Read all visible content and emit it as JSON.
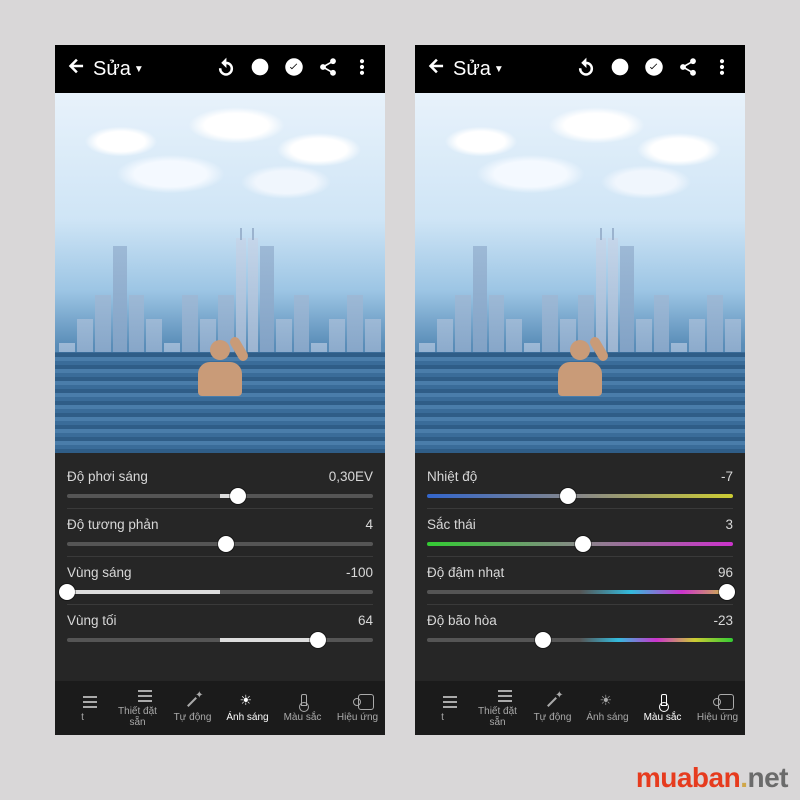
{
  "watermark": {
    "brand": "muaban",
    "dot": ".",
    "tld": "net"
  },
  "phones": [
    {
      "title": "Sửa",
      "sliders": [
        {
          "label": "Độ phơi sáng",
          "value": "0,30EV",
          "pct": 56
        },
        {
          "label": "Độ tương phản",
          "value": "4",
          "pct": 52
        },
        {
          "label": "Vùng sáng",
          "value": "-100",
          "pct": 0,
          "half": true
        },
        {
          "label": "Vùng tối",
          "value": "64",
          "pct": 82
        }
      ],
      "tabs": [
        {
          "label": "t",
          "icon": "sliders"
        },
        {
          "label": "Thiết đặt sẵn",
          "icon": "sliders"
        },
        {
          "label": "Tự động",
          "icon": "wand"
        },
        {
          "label": "Ánh sáng",
          "icon": "sun",
          "active": true
        },
        {
          "label": "Màu sắc",
          "icon": "therm"
        },
        {
          "label": "Hiệu ứng",
          "icon": "fx"
        }
      ]
    },
    {
      "title": "Sửa",
      "sliders": [
        {
          "label": "Nhiệt độ",
          "value": "-7",
          "pct": 46,
          "track": "temp"
        },
        {
          "label": "Sắc thái",
          "value": "3",
          "pct": 51,
          "track": "tint"
        },
        {
          "label": "Độ đậm nhạt",
          "value": "96",
          "pct": 98,
          "track": "vib"
        },
        {
          "label": "Độ bão hòa",
          "value": "-23",
          "pct": 38,
          "track": "sat"
        }
      ],
      "tabs": [
        {
          "label": "t",
          "icon": "sliders"
        },
        {
          "label": "Thiết đặt sẵn",
          "icon": "sliders"
        },
        {
          "label": "Tự động",
          "icon": "wand"
        },
        {
          "label": "Ánh sáng",
          "icon": "sun"
        },
        {
          "label": "Màu sắc",
          "icon": "therm",
          "active": true
        },
        {
          "label": "Hiệu ứng",
          "icon": "fx"
        }
      ]
    }
  ]
}
